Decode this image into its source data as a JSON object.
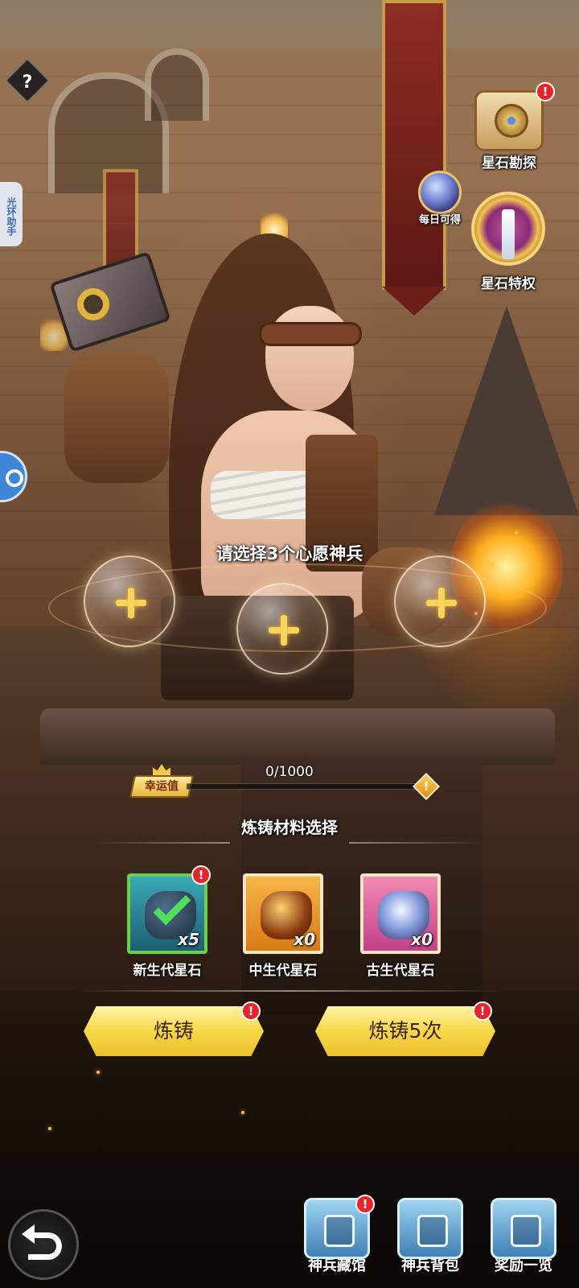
{
  "help": {
    "label": "?"
  },
  "side_tab": {
    "label": "光环助手"
  },
  "top_right": {
    "explore": {
      "label": "星石勘探",
      "alert": "!"
    },
    "daily": {
      "label": "每日可得"
    },
    "privilege": {
      "label": "星石特权"
    }
  },
  "wish": {
    "prompt": "请选择3个心愿神兵",
    "slots": [
      {
        "symbol": "+"
      },
      {
        "symbol": "+"
      },
      {
        "symbol": "+"
      }
    ]
  },
  "luck": {
    "label": "幸运值",
    "current": 0,
    "max": 1000,
    "text": "0/1000",
    "info_icon": "!"
  },
  "materials": {
    "title": "炼铸材料选择",
    "items": [
      {
        "name": "新生代星石",
        "count": "x5",
        "selected": true,
        "alert": "!",
        "border": "#6ad14a"
      },
      {
        "name": "中生代星石",
        "count": "x0",
        "selected": false,
        "border": "#f3e6c0"
      },
      {
        "name": "古生代星石",
        "count": "x0",
        "selected": false,
        "border": "#f3e6c0"
      }
    ]
  },
  "actions": {
    "forge": {
      "label": "炼铸",
      "alert": "!"
    },
    "forge5": {
      "label": "炼铸5次",
      "alert": "!"
    }
  },
  "bottom_nav": [
    {
      "label": "神兵藏馆",
      "alert": "!"
    },
    {
      "label": "神兵背包"
    },
    {
      "label": "奖励一览"
    }
  ],
  "colors": {
    "accent_yellow": "#f7d748",
    "alert_red": "#e8242a",
    "selected_green": "#4ee05a"
  }
}
